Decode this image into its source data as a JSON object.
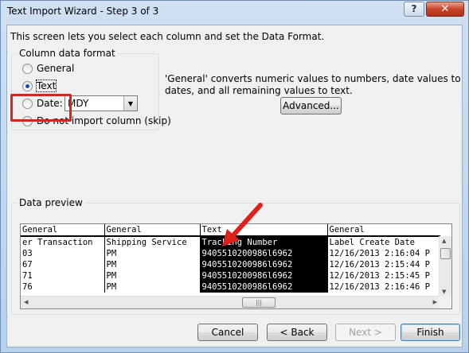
{
  "window": {
    "title": "Text Import Wizard - Step 3 of 3",
    "help_label": "?",
    "close_label": "✕"
  },
  "intro": "This screen lets you select each column and set the Data Format.",
  "format_group": {
    "label": "Column data format",
    "options": [
      {
        "label": "General",
        "checked": false
      },
      {
        "label": "Text",
        "checked": true
      },
      {
        "label": "Date:",
        "checked": false
      },
      {
        "label": "Do not import column (skip)",
        "checked": false
      }
    ],
    "date_value": "MDY"
  },
  "description": "'General' converts numeric values to numbers, date values to dates, and all remaining values to text.",
  "advanced_button": "Advanced...",
  "preview": {
    "label": "Data preview",
    "headers": [
      "General",
      "General",
      "Text",
      "General"
    ],
    "rows": [
      [
        "er Transaction",
        "Shipping Service",
        "Tracking Number",
        "Label Create Date"
      ],
      [
        "03",
        "PM",
        "9405510200986l6962",
        "12/16/2013 2:16:04 P"
      ],
      [
        "67",
        "PM",
        "9405510200986l6962",
        "12/16/2013 2:15:44 P"
      ],
      [
        "71",
        "PM",
        "9405510200986l6962",
        "12/16/2013 2:15:45 P"
      ],
      [
        "76",
        "PM",
        "9405510200986l6962",
        "12/16/2013 2:16:46 P"
      ]
    ],
    "selected_column": 2
  },
  "buttons": {
    "cancel": "Cancel",
    "back": "< Back",
    "next": "Next >",
    "finish": "Finish"
  },
  "colors": {
    "highlight": "#e1201c",
    "arrow": "#e1201c"
  }
}
